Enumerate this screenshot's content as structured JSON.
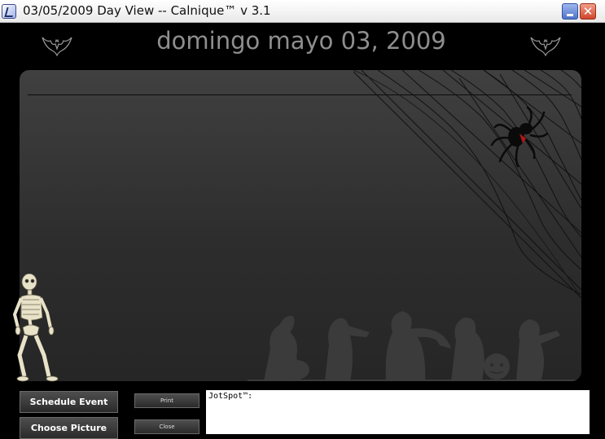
{
  "window": {
    "title": "03/05/2009 Day View -- Calnique™ v 3.1",
    "minimize_icon": "minimize-icon",
    "close_icon": "close-icon",
    "close_glyph": "✕"
  },
  "header": {
    "date": "domingo mayo 03, 2009",
    "left_icon": "bat-icon",
    "right_icon": "bat-icon"
  },
  "decorations": [
    "spider-web-image",
    "spider-image",
    "skeleton-image",
    "halloween-monsters-silhouette"
  ],
  "buttons": {
    "schedule_event": "Schedule Event",
    "choose_picture": "Choose Picture",
    "print": "Print",
    "close": "Close"
  },
  "jotspot": {
    "label": "JotSpot™:"
  },
  "colors": {
    "background": "#000000",
    "panel": "#333333",
    "header_text": "#8e8e8e",
    "spider_mark": "#b01818"
  }
}
